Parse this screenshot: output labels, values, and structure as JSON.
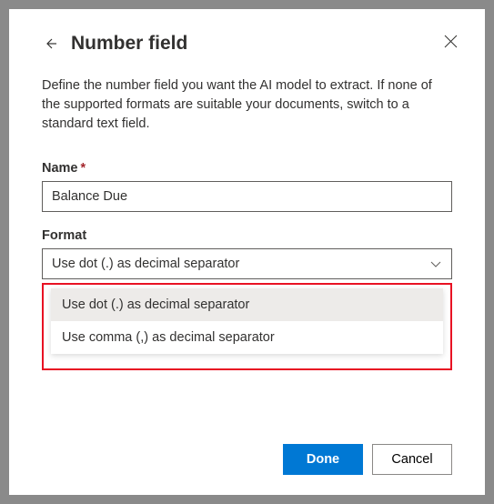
{
  "header": {
    "title": "Number field"
  },
  "description": "Define the number field you want the AI model to extract. If none of the supported formats are suitable your documents, switch to a standard text field.",
  "fields": {
    "name": {
      "label": "Name",
      "required": "*",
      "value": "Balance Due"
    },
    "format": {
      "label": "Format",
      "selected": "Use dot (.) as decimal separator",
      "options": [
        "Use dot (.) as decimal separator",
        "Use comma (,) as decimal separator"
      ]
    }
  },
  "footer": {
    "done": "Done",
    "cancel": "Cancel"
  }
}
